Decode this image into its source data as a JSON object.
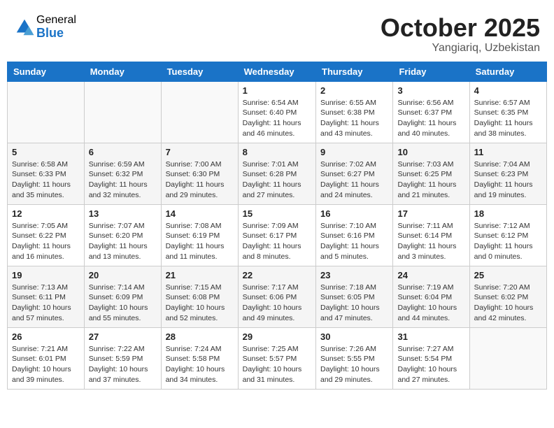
{
  "logo": {
    "general": "General",
    "blue": "Blue"
  },
  "title": "October 2025",
  "location": "Yangiariq, Uzbekistan",
  "weekdays": [
    "Sunday",
    "Monday",
    "Tuesday",
    "Wednesday",
    "Thursday",
    "Friday",
    "Saturday"
  ],
  "weeks": [
    [
      {
        "day": "",
        "info": ""
      },
      {
        "day": "",
        "info": ""
      },
      {
        "day": "",
        "info": ""
      },
      {
        "day": "1",
        "info": "Sunrise: 6:54 AM\nSunset: 6:40 PM\nDaylight: 11 hours\nand 46 minutes."
      },
      {
        "day": "2",
        "info": "Sunrise: 6:55 AM\nSunset: 6:38 PM\nDaylight: 11 hours\nand 43 minutes."
      },
      {
        "day": "3",
        "info": "Sunrise: 6:56 AM\nSunset: 6:37 PM\nDaylight: 11 hours\nand 40 minutes."
      },
      {
        "day": "4",
        "info": "Sunrise: 6:57 AM\nSunset: 6:35 PM\nDaylight: 11 hours\nand 38 minutes."
      }
    ],
    [
      {
        "day": "5",
        "info": "Sunrise: 6:58 AM\nSunset: 6:33 PM\nDaylight: 11 hours\nand 35 minutes."
      },
      {
        "day": "6",
        "info": "Sunrise: 6:59 AM\nSunset: 6:32 PM\nDaylight: 11 hours\nand 32 minutes."
      },
      {
        "day": "7",
        "info": "Sunrise: 7:00 AM\nSunset: 6:30 PM\nDaylight: 11 hours\nand 29 minutes."
      },
      {
        "day": "8",
        "info": "Sunrise: 7:01 AM\nSunset: 6:28 PM\nDaylight: 11 hours\nand 27 minutes."
      },
      {
        "day": "9",
        "info": "Sunrise: 7:02 AM\nSunset: 6:27 PM\nDaylight: 11 hours\nand 24 minutes."
      },
      {
        "day": "10",
        "info": "Sunrise: 7:03 AM\nSunset: 6:25 PM\nDaylight: 11 hours\nand 21 minutes."
      },
      {
        "day": "11",
        "info": "Sunrise: 7:04 AM\nSunset: 6:23 PM\nDaylight: 11 hours\nand 19 minutes."
      }
    ],
    [
      {
        "day": "12",
        "info": "Sunrise: 7:05 AM\nSunset: 6:22 PM\nDaylight: 11 hours\nand 16 minutes."
      },
      {
        "day": "13",
        "info": "Sunrise: 7:07 AM\nSunset: 6:20 PM\nDaylight: 11 hours\nand 13 minutes."
      },
      {
        "day": "14",
        "info": "Sunrise: 7:08 AM\nSunset: 6:19 PM\nDaylight: 11 hours\nand 11 minutes."
      },
      {
        "day": "15",
        "info": "Sunrise: 7:09 AM\nSunset: 6:17 PM\nDaylight: 11 hours\nand 8 minutes."
      },
      {
        "day": "16",
        "info": "Sunrise: 7:10 AM\nSunset: 6:16 PM\nDaylight: 11 hours\nand 5 minutes."
      },
      {
        "day": "17",
        "info": "Sunrise: 7:11 AM\nSunset: 6:14 PM\nDaylight: 11 hours\nand 3 minutes."
      },
      {
        "day": "18",
        "info": "Sunrise: 7:12 AM\nSunset: 6:12 PM\nDaylight: 11 hours\nand 0 minutes."
      }
    ],
    [
      {
        "day": "19",
        "info": "Sunrise: 7:13 AM\nSunset: 6:11 PM\nDaylight: 10 hours\nand 57 minutes."
      },
      {
        "day": "20",
        "info": "Sunrise: 7:14 AM\nSunset: 6:09 PM\nDaylight: 10 hours\nand 55 minutes."
      },
      {
        "day": "21",
        "info": "Sunrise: 7:15 AM\nSunset: 6:08 PM\nDaylight: 10 hours\nand 52 minutes."
      },
      {
        "day": "22",
        "info": "Sunrise: 7:17 AM\nSunset: 6:06 PM\nDaylight: 10 hours\nand 49 minutes."
      },
      {
        "day": "23",
        "info": "Sunrise: 7:18 AM\nSunset: 6:05 PM\nDaylight: 10 hours\nand 47 minutes."
      },
      {
        "day": "24",
        "info": "Sunrise: 7:19 AM\nSunset: 6:04 PM\nDaylight: 10 hours\nand 44 minutes."
      },
      {
        "day": "25",
        "info": "Sunrise: 7:20 AM\nSunset: 6:02 PM\nDaylight: 10 hours\nand 42 minutes."
      }
    ],
    [
      {
        "day": "26",
        "info": "Sunrise: 7:21 AM\nSunset: 6:01 PM\nDaylight: 10 hours\nand 39 minutes."
      },
      {
        "day": "27",
        "info": "Sunrise: 7:22 AM\nSunset: 5:59 PM\nDaylight: 10 hours\nand 37 minutes."
      },
      {
        "day": "28",
        "info": "Sunrise: 7:24 AM\nSunset: 5:58 PM\nDaylight: 10 hours\nand 34 minutes."
      },
      {
        "day": "29",
        "info": "Sunrise: 7:25 AM\nSunset: 5:57 PM\nDaylight: 10 hours\nand 31 minutes."
      },
      {
        "day": "30",
        "info": "Sunrise: 7:26 AM\nSunset: 5:55 PM\nDaylight: 10 hours\nand 29 minutes."
      },
      {
        "day": "31",
        "info": "Sunrise: 7:27 AM\nSunset: 5:54 PM\nDaylight: 10 hours\nand 27 minutes."
      },
      {
        "day": "",
        "info": ""
      }
    ]
  ]
}
